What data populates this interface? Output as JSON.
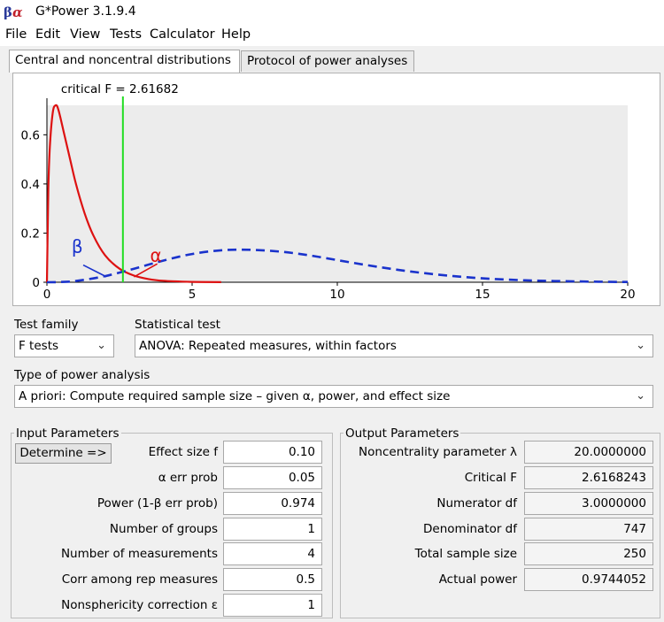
{
  "window": {
    "icon": "gpower-icon",
    "title": "G*Power 3.1.9.4"
  },
  "menu": [
    "File",
    "Edit",
    "View",
    "Tests",
    "Calculator",
    "Help"
  ],
  "tabs": [
    {
      "label": "Central and noncentral distributions",
      "active": true
    },
    {
      "label": "Protocol of power analyses",
      "active": false
    }
  ],
  "chart_data": {
    "type": "line",
    "critical_label": "critical F = 2.61682",
    "critical_value": 2.61682,
    "xlim": [
      0,
      20
    ],
    "ylim": [
      0,
      0.72
    ],
    "x_ticks": [
      "0",
      "5",
      "10",
      "15",
      "20"
    ],
    "y_ticks": [
      "0",
      "0.2",
      "0.4",
      "0.6"
    ],
    "series": [
      {
        "color": "#dd1111",
        "style": "solid",
        "x": [
          0.05,
          0.1,
          0.2,
          0.3,
          0.4,
          0.6,
          0.8,
          1.0,
          1.3,
          1.6,
          2.0,
          2.5,
          3.0,
          3.5,
          4.0,
          5.0,
          6.0
        ],
        "y": [
          0.38,
          0.55,
          0.69,
          0.72,
          0.7,
          0.6,
          0.5,
          0.4,
          0.28,
          0.19,
          0.11,
          0.055,
          0.027,
          0.013,
          0.006,
          0.0015,
          0.0003
        ]
      },
      {
        "color": "#1a33cc",
        "style": "dashed",
        "x": [
          0,
          0.5,
          1,
          2,
          3,
          4,
          5,
          6,
          7,
          8,
          9,
          10,
          11,
          12,
          13,
          14,
          15,
          16,
          17,
          18,
          19,
          20
        ],
        "y": [
          0,
          0.001,
          0.005,
          0.025,
          0.055,
          0.088,
          0.115,
          0.13,
          0.132,
          0.125,
          0.11,
          0.09,
          0.07,
          0.052,
          0.037,
          0.025,
          0.016,
          0.01,
          0.006,
          0.004,
          0.002,
          0.001
        ]
      }
    ],
    "annotations": [
      {
        "text": "β",
        "color": "#1a33cc"
      },
      {
        "text": "α",
        "color": "#dd1111"
      }
    ]
  },
  "test_family": {
    "label": "Test family",
    "value": "F tests"
  },
  "statistical_test": {
    "label": "Statistical test",
    "value": "ANOVA: Repeated measures, within factors"
  },
  "power_analysis": {
    "label": "Type of power analysis",
    "value": "A priori: Compute required sample size – given α, power, and effect size"
  },
  "input": {
    "title": "Input Parameters",
    "determine": "Determine =>",
    "rows": [
      {
        "label": "Effect size f",
        "value": "0.10"
      },
      {
        "label": "α err prob",
        "value": "0.05"
      },
      {
        "label": "Power (1-β err prob)",
        "value": "0.974"
      },
      {
        "label": "Number of groups",
        "value": "1"
      },
      {
        "label": "Number of measurements",
        "value": "4"
      },
      {
        "label": "Corr among rep measures",
        "value": "0.5"
      },
      {
        "label": "Nonsphericity correction ε",
        "value": "1"
      }
    ]
  },
  "output": {
    "title": "Output Parameters",
    "rows": [
      {
        "label": "Noncentrality parameter λ",
        "value": "20.0000000"
      },
      {
        "label": "Critical F",
        "value": "2.6168243"
      },
      {
        "label": "Numerator df",
        "value": "3.0000000"
      },
      {
        "label": "Denominator df",
        "value": "747"
      },
      {
        "label": "Total sample size",
        "value": "250"
      },
      {
        "label": "Actual power",
        "value": "0.9744052"
      }
    ]
  }
}
